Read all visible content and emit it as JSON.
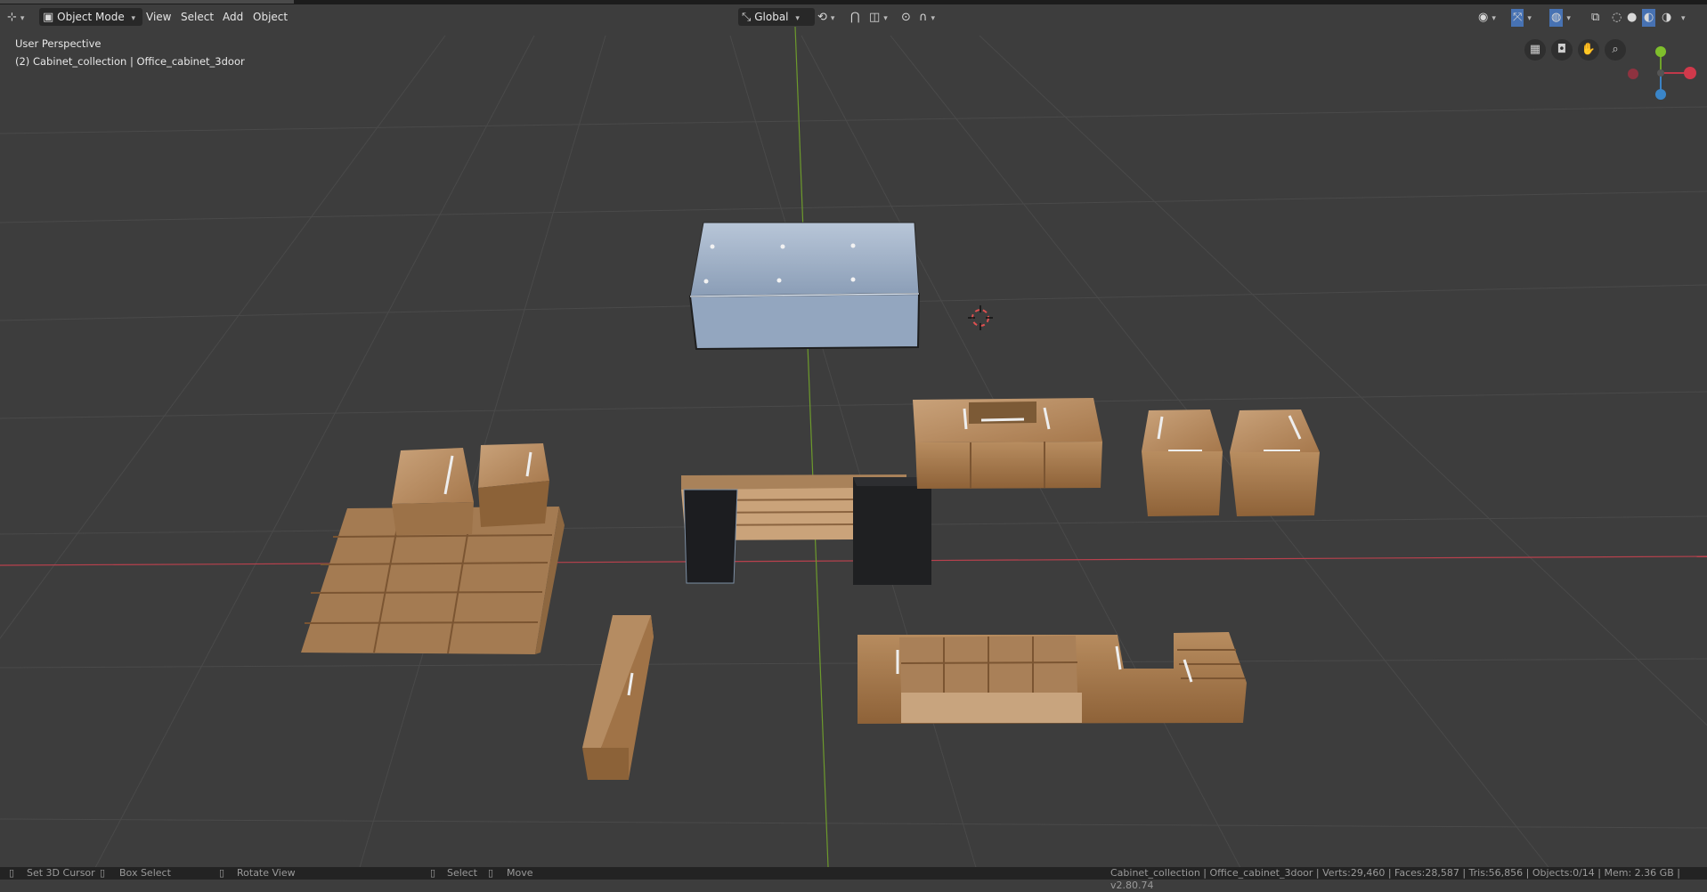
{
  "header": {
    "editor_type_icon": "axes-icon",
    "mode_label": "Object Mode",
    "menus": [
      "View",
      "Select",
      "Add",
      "Object"
    ],
    "transform_orientation": "Global"
  },
  "viewport": {
    "perspective_label": "User Perspective",
    "collection_label": "(2) Cabinet_collection | Office_cabinet_3door",
    "gizmo_axes": [
      "X",
      "Y",
      "Z"
    ]
  },
  "statusbar": {
    "left_items": [
      "Set 3D Cursor",
      "Box Select",
      "Rotate View",
      "Select",
      "Move"
    ],
    "stats": "Cabinet_collection | Office_cabinet_3door | Verts:29,460 | Faces:28,587 | Tris:56,856 | Objects:0/14 | Mem: 2.36 GB | v2.80.74"
  },
  "colors": {
    "viewport_bg": "#3d3d3d",
    "x_axis": "#c0394a",
    "y_axis": "#6ea22b",
    "z_axis": "#3b82c4",
    "wood": "#b58a5c",
    "glass": "#9fb2c8",
    "black_cabinet": "#1f2022"
  }
}
